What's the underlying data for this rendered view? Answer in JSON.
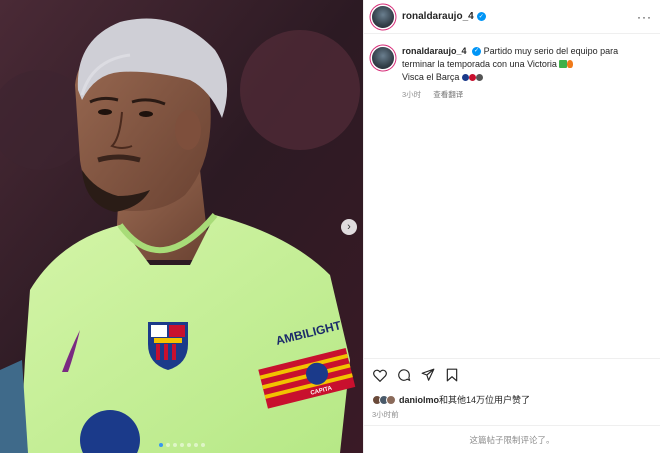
{
  "colors": {
    "accent": "#0095f6",
    "secondary_text": "#8e8e8e",
    "border": "#efefef"
  },
  "media": {
    "image_alt_icon": "photo",
    "next_icon": "chevron-right-icon",
    "carousel_total": 7,
    "carousel_active_index": 0,
    "jersey_sponsor": "AMBILIGHT",
    "armband_text": "CAPITA"
  },
  "header": {
    "username": "ronaldaraujo_4",
    "more_label": "···"
  },
  "caption": {
    "username": "ronaldaraujo_4",
    "text_line1": "Partido muy serio del equipo para terminar la temporada con una Victoria",
    "text_line2": "Visca el Barça",
    "time": "3小时",
    "translate": "查看翻译"
  },
  "actions": {
    "like_icon": "heart-icon",
    "comment_icon": "comment-icon",
    "share_icon": "send-icon",
    "save_icon": "bookmark-icon"
  },
  "likes": {
    "liker": "daniolmo",
    "rest": "和其他14万位用户赞了"
  },
  "post_time": "3小时前",
  "comments_disabled": "这篇帖子限制评论了。"
}
